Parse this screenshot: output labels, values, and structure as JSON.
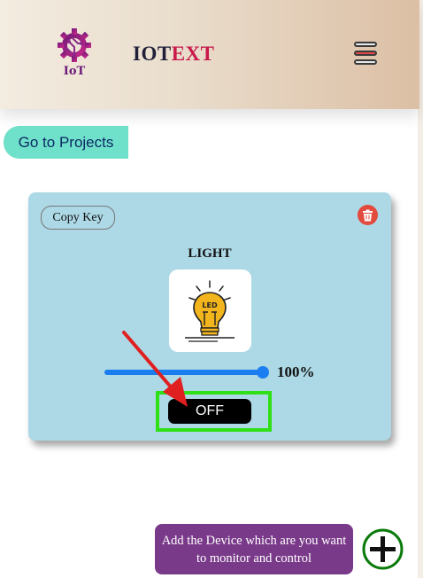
{
  "header": {
    "logo_text": "IoT",
    "brand_part1": "IOT",
    "brand_part2": "EXT",
    "icons": {
      "logo": "iot-gear-circuit-icon",
      "menu": "hamburger-menu-icon"
    }
  },
  "nav": {
    "go_to_projects_label": "Go to Projects"
  },
  "device_card": {
    "copy_key_label": "Copy Key",
    "title": "LIGHT",
    "image": "led-bulb-icon",
    "brightness_percent": 100,
    "brightness_label": "100%",
    "toggle_label": "OFF",
    "icons": {
      "delete": "trash-icon"
    }
  },
  "footer": {
    "hint_text": "Add the Device which are you want to monitor and control",
    "add_icon": "plus-circle-icon"
  },
  "colors": {
    "header_gradient_start": "#f3ece0",
    "header_gradient_end": "#dcbfa4",
    "brand_dark": "#1f1f3a",
    "brand_accent": "#c8194a",
    "go_button": "#6fe0c9",
    "card_bg": "#add8e6",
    "slider": "#1a7ef0",
    "delete": "#e24a3e",
    "highlight_box": "#2ee014",
    "annotation_arrow": "#e02020",
    "tooltip_bg": "#7a3a8a",
    "add_button": "#0a7a0a"
  }
}
